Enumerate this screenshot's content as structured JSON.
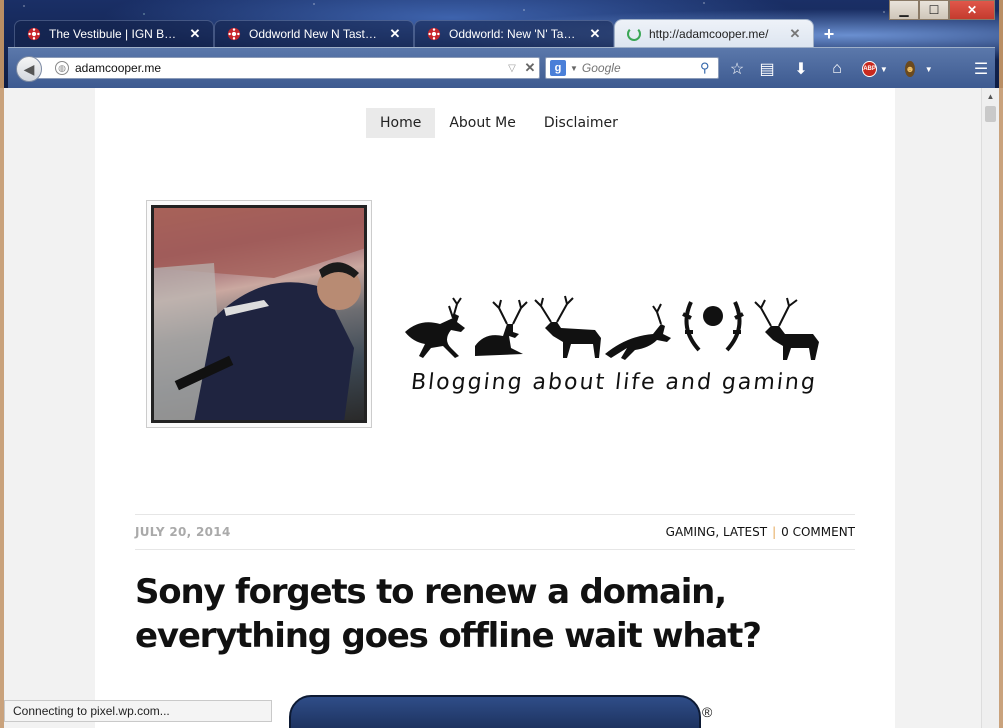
{
  "browser": {
    "tabs": [
      {
        "title": "The Vestibule | IGN Boards",
        "favicon": "ign-icon",
        "active": false
      },
      {
        "title": "Oddworld New N Tasty 8...",
        "favicon": "ign-icon",
        "active": false
      },
      {
        "title": "Oddworld: New 'N' Tasty...",
        "favicon": "ign-icon",
        "active": false
      },
      {
        "title": "http://adamcooper.me/",
        "favicon": "loading-spinner-icon",
        "active": true
      }
    ],
    "new_tab_label": "+",
    "url": "adamcooper.me",
    "search_placeholder": "Google",
    "caption": {
      "minimize": "▁",
      "maximize": "☐",
      "close": "✕"
    },
    "status": "Connecting to pixel.wp.com..."
  },
  "site": {
    "menu": [
      {
        "label": "Home",
        "current": true
      },
      {
        "label": "About Me",
        "current": false
      },
      {
        "label": "Disclaimer",
        "current": false
      }
    ],
    "tagline": "Blogging about life and gaming",
    "post": {
      "date": "JULY 20, 2014",
      "categories": [
        "GAMING",
        "LATEST"
      ],
      "comment_count": "0 COMMENT",
      "title": "Sony forgets to renew a domain, everything goes offline wait what?"
    },
    "registered_mark": "®"
  },
  "colors": {
    "window_frame": "#b98e64",
    "navbar": "#4a6aa0",
    "separator_accent": "#e6a95a",
    "close_button": "#c43b2e"
  }
}
